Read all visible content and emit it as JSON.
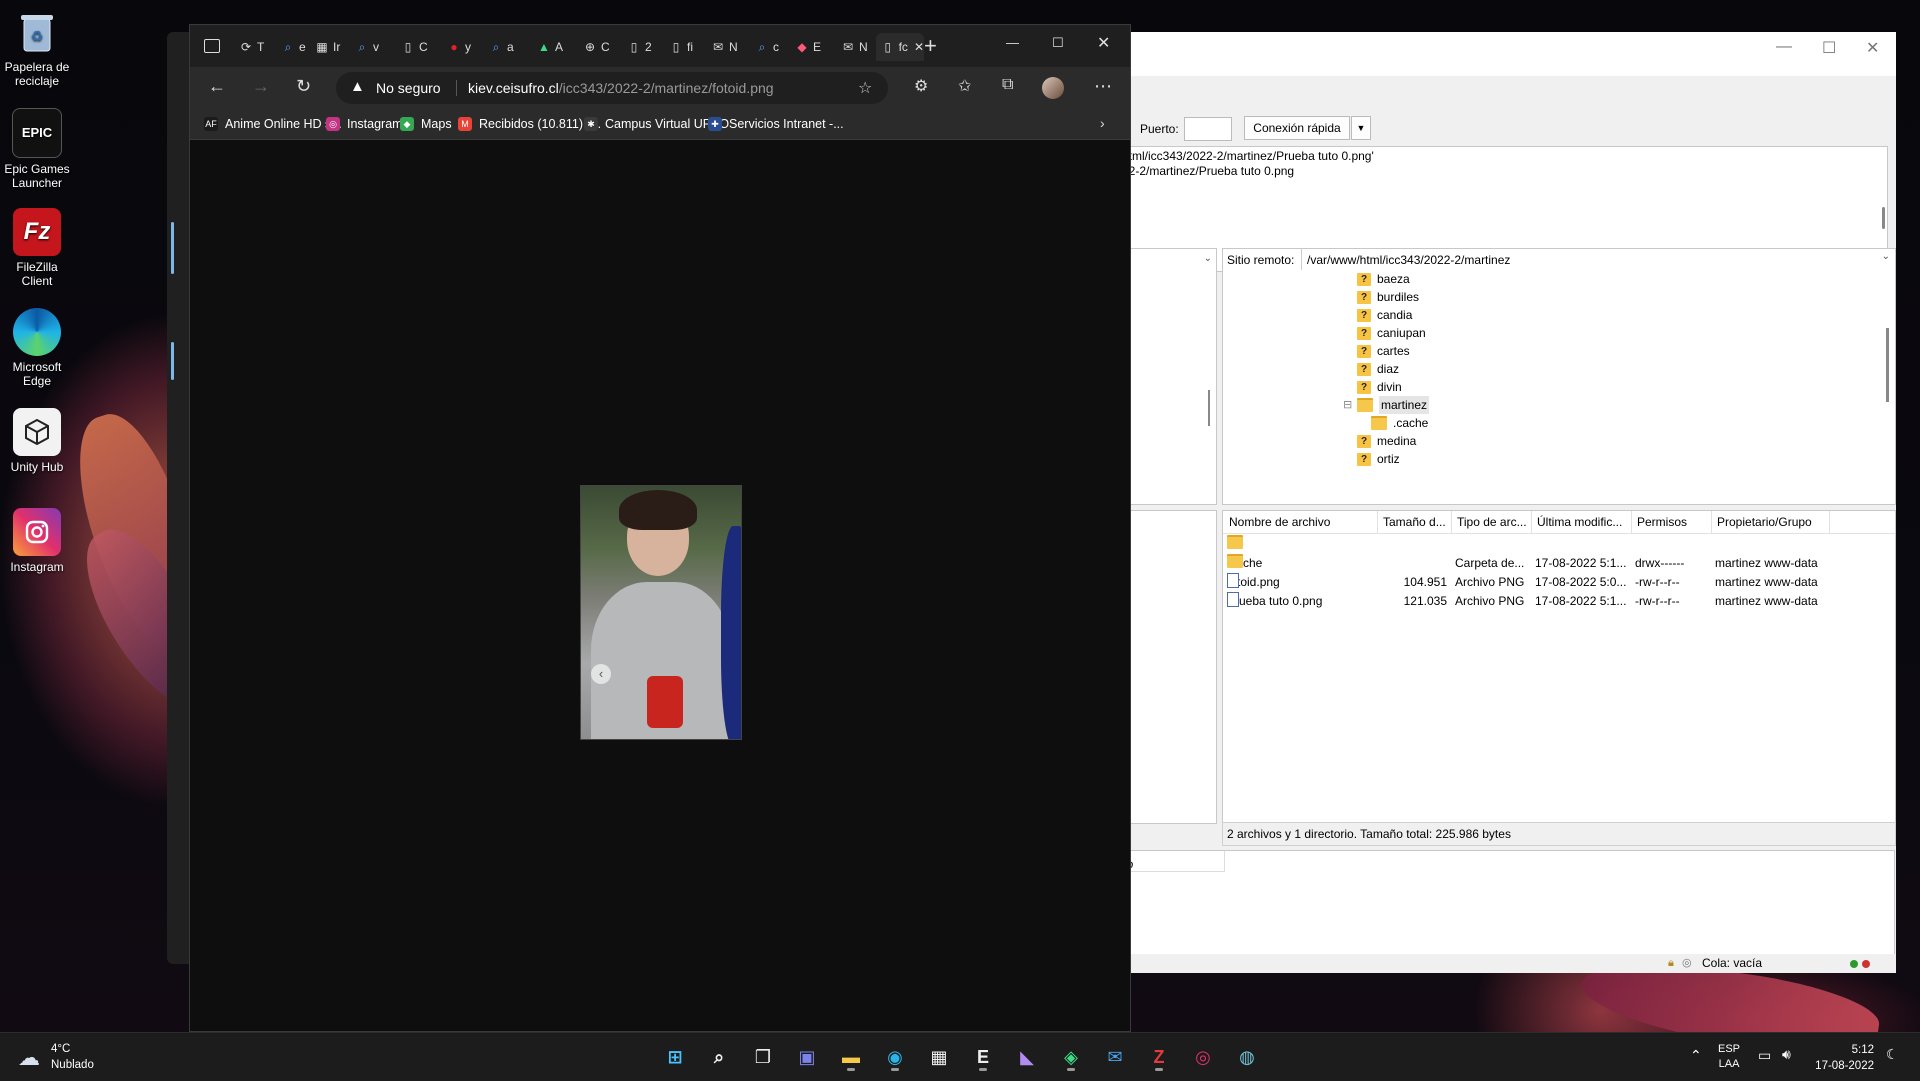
{
  "desktop": {
    "icons": [
      {
        "label": "Papelera de reciclaje",
        "icon": "recycle-bin-icon"
      },
      {
        "label": "Epic Games Launcher",
        "icon": "epic-games-icon",
        "glyph": "EPIC"
      },
      {
        "label": "FileZilla Client",
        "icon": "filezilla-icon",
        "glyph": "Fz"
      },
      {
        "label": "Microsoft Edge",
        "icon": "edge-icon"
      },
      {
        "label": "Unity Hub",
        "icon": "unity-icon"
      },
      {
        "label": "Instagram",
        "icon": "instagram-icon"
      }
    ]
  },
  "browser": {
    "tabs": [
      {
        "label": "T",
        "icon": "edge-refresh-icon"
      },
      {
        "label": "e",
        "icon": "search-icon"
      },
      {
        "label": "Ir",
        "icon": "document-grid-icon"
      },
      {
        "label": "v",
        "icon": "search-icon"
      },
      {
        "label": "C",
        "icon": "page-icon"
      },
      {
        "label": "y",
        "icon": "red-app-icon"
      },
      {
        "label": "a",
        "icon": "search-icon"
      },
      {
        "label": "A",
        "icon": "android-icon"
      },
      {
        "label": "C",
        "icon": "globe-icon"
      },
      {
        "label": "2",
        "icon": "page-icon"
      },
      {
        "label": "fi",
        "icon": "page-icon"
      },
      {
        "label": "N",
        "icon": "mail-icon"
      },
      {
        "label": "c",
        "icon": "search-icon"
      },
      {
        "label": "E",
        "icon": "diamond-icon"
      },
      {
        "label": "N",
        "icon": "mail-icon"
      },
      {
        "label": "fc",
        "icon": "page-icon",
        "active": true
      }
    ],
    "security_label": "No seguro",
    "url_host": "kiev.ceisufro.cl",
    "url_path": "/icc343/2022-2/martinez/fotoid.png",
    "favorites": [
      {
        "label": "Anime Online HD s...",
        "glyph": "AF",
        "color": "#1b1b1b"
      },
      {
        "label": "Instagram",
        "glyph": "◎",
        "color": "#c13584"
      },
      {
        "label": "Maps",
        "glyph": "◆",
        "color": "#34a853"
      },
      {
        "label": "Recibidos (10.811) -...",
        "glyph": "M",
        "color": "#ea4335"
      },
      {
        "label": "Campus Virtual UFRO",
        "glyph": "✱",
        "color": "#3a3a3a"
      },
      {
        "label": "Servicios Intranet -...",
        "glyph": "✚",
        "color": "#2a4d8f"
      }
    ],
    "image_alt": "fotoid.png"
  },
  "filezilla": {
    "port_label": "Puerto:",
    "port_value": "",
    "quickconnect_label": "Conexión rápida",
    "log_lines": [
      "html/icc343/2022-2/martinez/Prueba tuto 0.png'",
      "22-2/martinez/Prueba tuto 0.png"
    ],
    "remote_site_label": "Sitio remoto:",
    "remote_path": "/var/www/html/icc343/2022-2/martinez",
    "tree": [
      {
        "name": "baeza",
        "type": "unknown"
      },
      {
        "name": "burdiles",
        "type": "unknown"
      },
      {
        "name": "candia",
        "type": "unknown"
      },
      {
        "name": "caniupan",
        "type": "unknown"
      },
      {
        "name": "cartes",
        "type": "unknown"
      },
      {
        "name": "diaz",
        "type": "unknown"
      },
      {
        "name": "divin",
        "type": "unknown"
      },
      {
        "name": "martinez",
        "type": "open"
      },
      {
        "name": ".cache",
        "type": "folder"
      },
      {
        "name": "medina",
        "type": "unknown"
      },
      {
        "name": "ortiz",
        "type": "unknown"
      }
    ],
    "columns": [
      "Nombre de archivo",
      "Tamaño d...",
      "Tipo de arc...",
      "Última modific...",
      "Permisos",
      "Propietario/Grupo"
    ],
    "files": [
      {
        "name": "..",
        "size": "",
        "type": "",
        "modified": "",
        "perms": "",
        "owner": "",
        "kind": "folder"
      },
      {
        "name": ".cache",
        "size": "",
        "type": "Carpeta de...",
        "modified": "17-08-2022 5:1...",
        "perms": "drwx------",
        "owner": "martinez www-data",
        "kind": "folder"
      },
      {
        "name": "fotoid.png",
        "size": "104.951",
        "type": "Archivo PNG",
        "modified": "17-08-2022 5:0...",
        "perms": "-rw-r--r--",
        "owner": "martinez www-data",
        "kind": "file"
      },
      {
        "name": "Prueba tuto 0.png",
        "size": "121.035",
        "type": "Archivo PNG",
        "modified": "17-08-2022 5:1...",
        "perms": "-rw-r--r--",
        "owner": "martinez www-data",
        "kind": "file"
      }
    ],
    "status_summary": "2 archivos y 1 directorio. Tamaño total: 225.986 bytes",
    "transfer_status_fragment": "do",
    "queue_label": "Cola: vacía"
  },
  "taskbar": {
    "weather_temp": "4°C",
    "weather_desc": "Nublado",
    "lang_line1": "ESP",
    "lang_line2": "LAA",
    "time": "5:12",
    "date": "17-08-2022",
    "apps": [
      {
        "name": "start-icon"
      },
      {
        "name": "search-icon"
      },
      {
        "name": "task-view-icon"
      },
      {
        "name": "teams-chat-icon"
      },
      {
        "name": "file-explorer-icon"
      },
      {
        "name": "edge-icon"
      },
      {
        "name": "store-icon"
      },
      {
        "name": "epic-games-icon"
      },
      {
        "name": "visual-studio-icon"
      },
      {
        "name": "android-studio-icon"
      },
      {
        "name": "mail-icon"
      },
      {
        "name": "filezilla-icon"
      },
      {
        "name": "instagram-icon"
      },
      {
        "name": "globe-app-icon"
      }
    ]
  }
}
